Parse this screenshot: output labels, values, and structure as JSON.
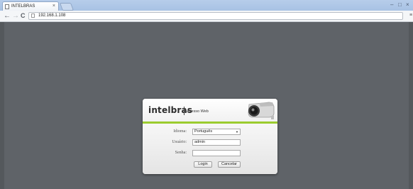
{
  "browser": {
    "tab_title": "INTELBRAS",
    "tab_close": "×",
    "address": "192.168.1.108",
    "back": "←",
    "forward": "→",
    "reload": "C",
    "menu": "≡",
    "minimize": "–",
    "maximize": "□",
    "close": "×"
  },
  "login": {
    "brand": "intelbras",
    "subtitle": "Acesso Web",
    "language_label": "Idioma:",
    "language_value": "Português",
    "user_label": "Usuário:",
    "user_value": "admin",
    "password_label": "Senha:",
    "password_value": "",
    "login_button": "Login",
    "cancel_button": "Cancelar"
  },
  "colors": {
    "page_background": "#5f6368",
    "accent": "#9ccc2f"
  },
  "icons": [
    "favicon-icon",
    "page-icon",
    "security-camera-icon",
    "dropdown-arrow-icon",
    "menu-icon"
  ]
}
